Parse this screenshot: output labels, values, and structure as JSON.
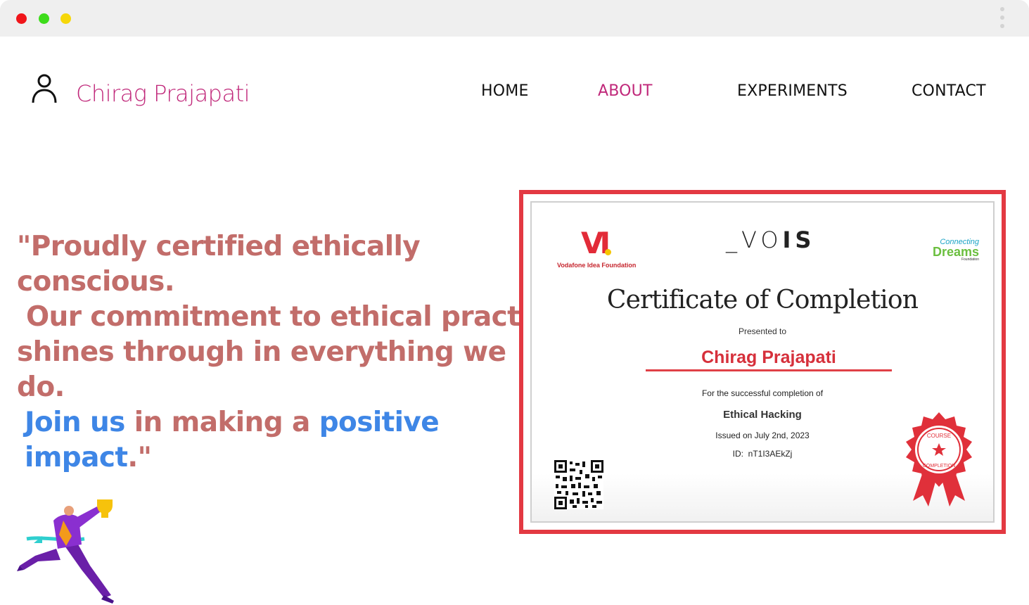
{
  "window": {
    "dots": [
      "#f0151a",
      "#3ddc1b",
      "#f6d70a"
    ]
  },
  "header": {
    "brand": {
      "icon": "user-icon",
      "name": "Chirag Prajapati"
    },
    "nav": [
      {
        "label": "HOME",
        "active": false
      },
      {
        "label": "ABOUT",
        "active": true
      },
      {
        "label": "EXPERIMENTS",
        "active": false
      },
      {
        "label": "CONTACT",
        "active": false
      }
    ]
  },
  "hero": {
    "line1": "\"Proudly certified ethically conscious.",
    "line2": " Our commitment to ethical practices",
    "line3": "shines through in everything we do.",
    "line4_join": "Join us",
    "line4_mid": " in making a ",
    "line4_positive": "positive impact",
    "line4_end": ".\"",
    "illustration": "runner-trophy-illustration"
  },
  "certificate": {
    "vi_logo": "VI",
    "vi_caption": "Vodafone Idea Foundation",
    "vois_prefix": "_VO",
    "vois_suffix": "IS",
    "cd_line1": "Connecting",
    "cd_line2": "Dreams",
    "cd_line3": "Foundation",
    "title": "Certificate of Completion",
    "presented": "Presented to",
    "recipient": "Chirag Prajapati",
    "completion_text": "For the successful completion of",
    "course": "Ethical Hacking",
    "issued": "Issued on July 2nd, 2023",
    "id": "ID:  nT1I3AEkZj",
    "badge_top": "COURSE",
    "badge_bottom": "COMPLETION",
    "colors": {
      "frame": "#e33942",
      "accent": "#d6303b"
    }
  },
  "colors": {
    "brand": "#c0287a",
    "quote": "#c26d6a",
    "quote_highlight": "#3e86e6"
  }
}
